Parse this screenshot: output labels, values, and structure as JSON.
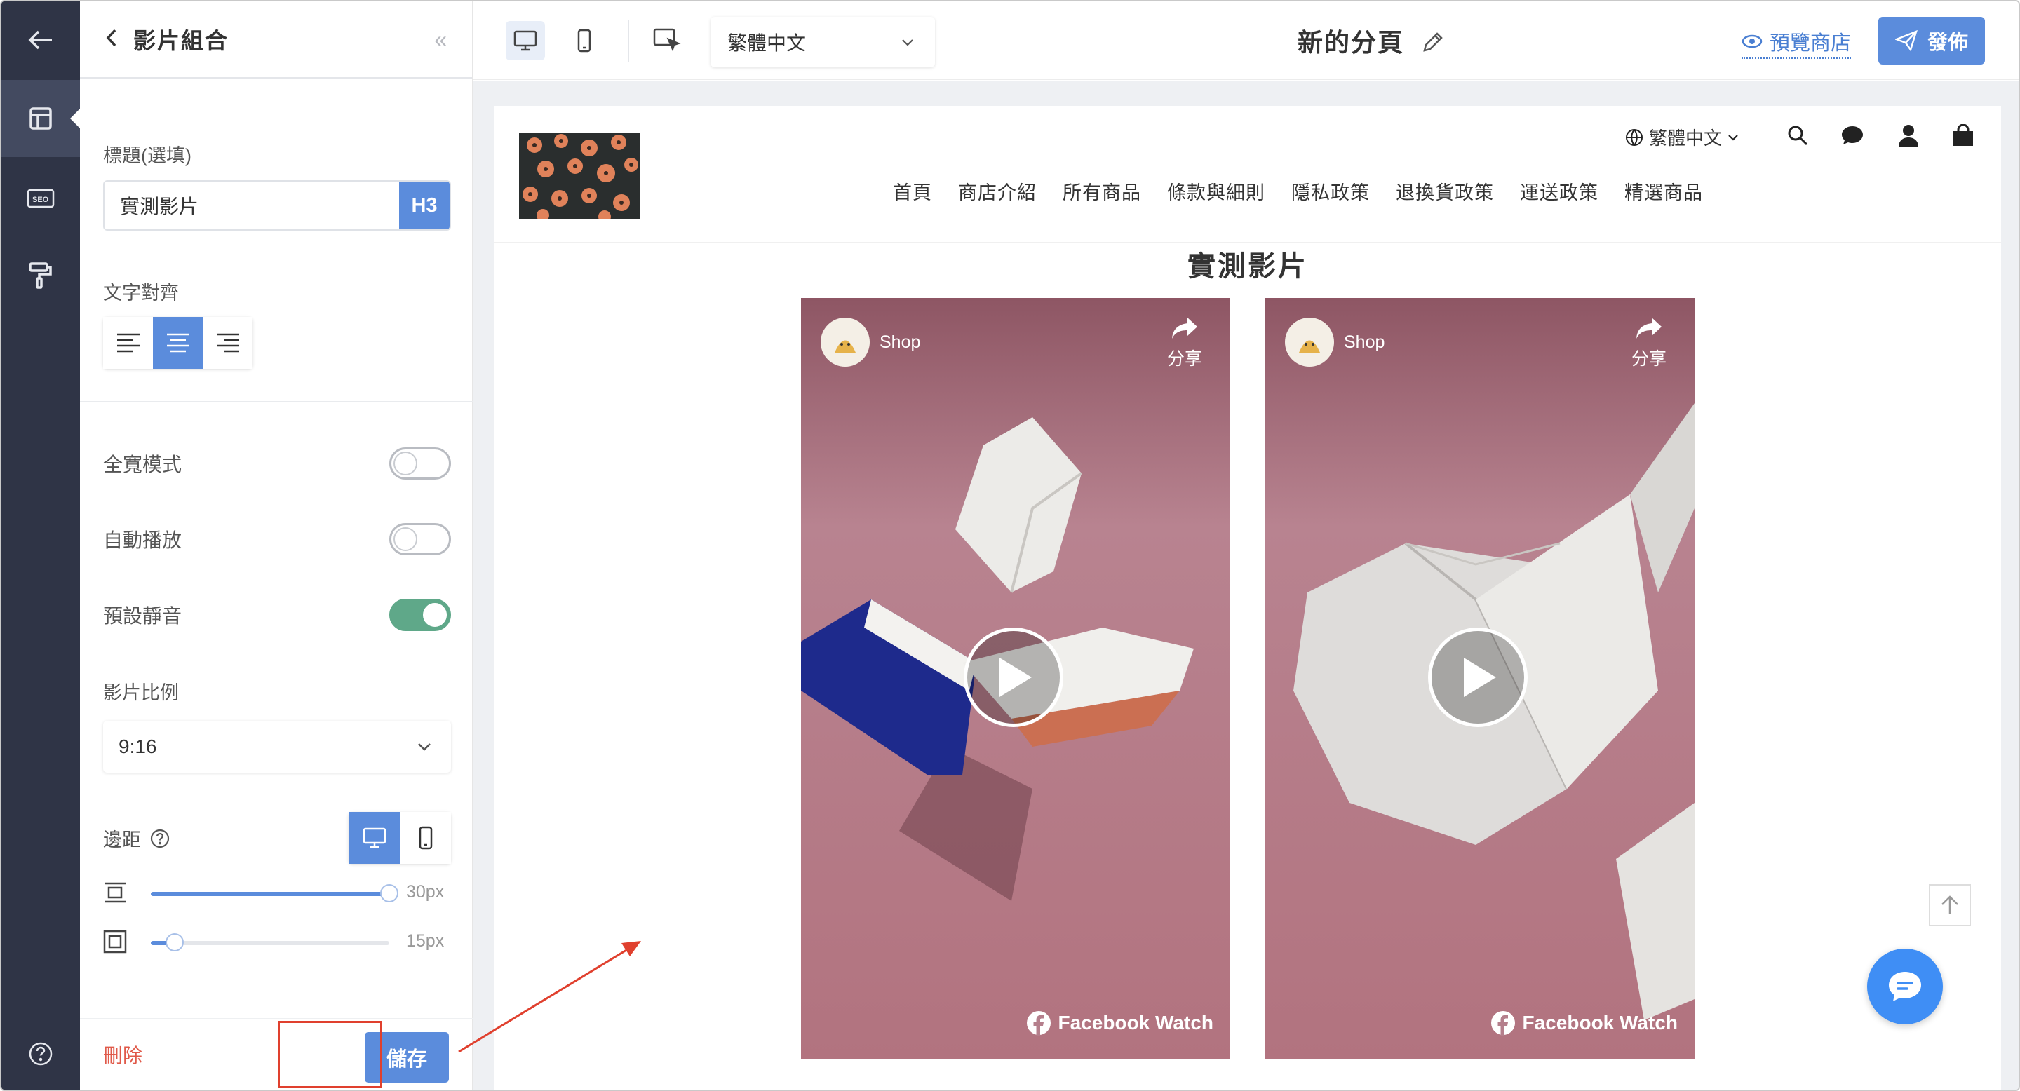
{
  "panel": {
    "title": "影片組合",
    "heading_label": "標題(選填)",
    "heading_value": "實測影片",
    "heading_level": "H3",
    "align_label": "文字對齊",
    "fullwidth_label": "全寬模式",
    "autoplay_label": "自動播放",
    "mute_label": "預設靜音",
    "fullwidth_on": false,
    "autoplay_on": false,
    "mute_on": true,
    "ratio_label": "影片比例",
    "ratio_value": "9:16",
    "margin_label": "邊距",
    "margin_top_value": "30px",
    "margin_top_fill": 1.0,
    "padding_value": "15px",
    "padding_fill": 0.1,
    "delete_label": "刪除",
    "save_label": "儲存"
  },
  "toolbar": {
    "language": "繁體中文",
    "page_title": "新的分頁",
    "preview_label": "預覽商店",
    "publish_label": "發佈"
  },
  "site": {
    "language": "繁體中文",
    "nav": [
      "首頁",
      "商店介紹",
      "所有商品",
      "條款與細則",
      "隱私政策",
      "退換貨政策",
      "運送政策",
      "精選商品"
    ],
    "section_title": "實測影片",
    "videos": [
      {
        "channel": "Shop",
        "share": "分享",
        "brand": "Facebook Watch"
      },
      {
        "channel": "Shop",
        "share": "分享",
        "brand": "Facebook Watch"
      }
    ]
  },
  "colors": {
    "accent": "#5b8cdc",
    "rail": "#2f3446",
    "toggle_on": "#5fa889",
    "highlight": "#e0402e"
  }
}
